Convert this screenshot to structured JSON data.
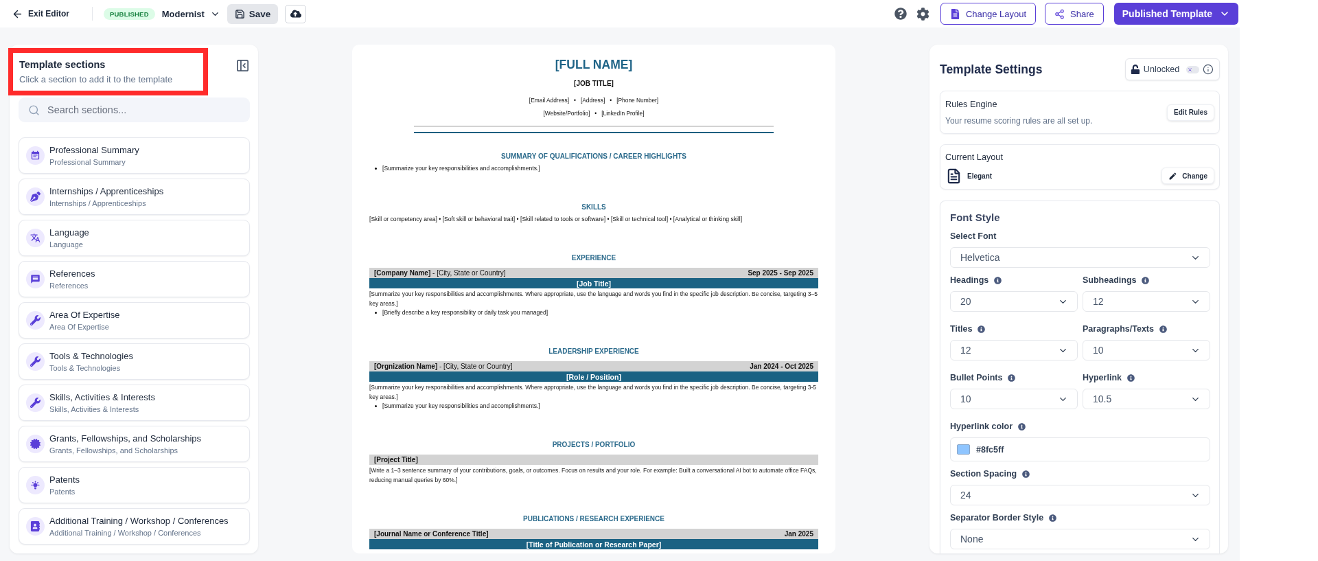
{
  "top_bar": {
    "exit_label": "Exit Editor",
    "status_badge": "PUBLISHED",
    "template_name": "Modernist",
    "save_label": "Save",
    "actions": [
      {
        "kind": "layout",
        "label": "Change Layout"
      },
      {
        "kind": "share",
        "label": "Share"
      }
    ],
    "publish_label": "Published Template"
  },
  "sections_panel": {
    "title": "Template sections",
    "subtitle": "Click a section to add it to the template",
    "highlighted": true,
    "search": {
      "placeholder": "Search sections..."
    },
    "items": [
      {
        "kind": "summary",
        "title": "Professional Summary",
        "subtitle": "Professional Summary"
      },
      {
        "kind": "internship",
        "title": "Internships / Apprenticeships",
        "subtitle": "Internships / Apprenticeships"
      },
      {
        "kind": "language",
        "title": "Language",
        "subtitle": "Language"
      },
      {
        "kind": "references",
        "title": "References",
        "subtitle": "References"
      },
      {
        "kind": "expertise",
        "title": "Area Of Expertise",
        "subtitle": "Area Of Expertise"
      },
      {
        "kind": "tools",
        "title": "Tools & Technologies",
        "subtitle": "Tools & Technologies"
      },
      {
        "kind": "skills",
        "title": "Skills, Activities & Interests",
        "subtitle": "Skills, Activities & Interests"
      },
      {
        "kind": "grants",
        "title": "Grants, Fellowships, and Scholarships",
        "subtitle": "Grants, Fellowships, and Scholarships"
      },
      {
        "kind": "patents",
        "title": "Patents",
        "subtitle": "Patents"
      },
      {
        "kind": "training",
        "title": "Additional Training / Workshop / Conferences",
        "subtitle": "Additional Training / Workshop / Conferences"
      }
    ]
  },
  "resume": {
    "name": "[FULL NAME]",
    "job_title": "[JOB TITLE]",
    "contact_lines": [
      "[Email Address]   •   [Address]   •   [Phone Number]",
      "[Website/Portfolio]   •   [LinkedIn Profile]"
    ],
    "sections": [
      {
        "kind": "bullets",
        "heading": "SUMMARY OF QUALIFICATIONS / CAREER HIGHLIGHTS",
        "bullets": [
          "[Summarize your key responsibilities and accomplishments.]"
        ]
      },
      {
        "kind": "line",
        "heading": "SKILLS",
        "text": "[Skill or competency area] • [Soft skill or behavioral trait] • [Skill related to tools or software] • [Skill or technical tool] • [Analytical or thinking skill]"
      },
      {
        "kind": "entries",
        "heading": "EXPERIENCE",
        "entries": [
          {
            "name": "[Company Name]",
            "location": "- [City, State or Country]",
            "dates": "Sep 2025 - Sep 2025",
            "role": "[Job Title]",
            "description": "[Summarize your key responsibilities and accomplishments. Where appropriate, use the language and words you find in the specific job description. Be concise, targeting 3–5 key areas.]",
            "bullets": [
              "[Briefly describe a key responsibility or daily task you managed]"
            ]
          }
        ]
      },
      {
        "kind": "entries",
        "heading": "LEADERSHIP EXPERIENCE",
        "entries": [
          {
            "name": "[Orgnization Name]",
            "location": "- [City, State or Country]",
            "dates": "Jan 2024 - Oct 2025",
            "role": "[Role / Position]",
            "description": "[Summarize your key responsibilities and accomplishments. Where appropriate, use the language and words you find in the specific job description. Be concise, targeting 3-5 key areas.]",
            "bullets": [
              "[Summarize your key responsibilities and accomplishments.]"
            ]
          }
        ]
      },
      {
        "kind": "entries",
        "heading": "PROJECTS / PORTFOLIO",
        "entries": [
          {
            "name": "[Project Title]",
            "description": "[Write a 1–3 sentence summary of your contributions, goals, or outcomes. Focus on results and your role. For example: Built a conversational AI bot to automate office FAQs, reducing manual queries by 60%.]"
          }
        ]
      },
      {
        "kind": "entries",
        "heading": "PUBLICATIONS / RESEARCH EXPERIENCE",
        "entries": [
          {
            "name": "[Journal Name or Conference Title]",
            "dates": "Jan 2025",
            "role": "[Title of Publication or Research Paper]"
          }
        ]
      }
    ]
  },
  "settings": {
    "title": "Template Settings",
    "lock": {
      "label": "Unlocked",
      "locked": false
    },
    "rules_engine": {
      "title": "Rules Engine",
      "description": "Your resume scoring rules are all set up.",
      "button": "Edit Rules"
    },
    "layout": {
      "title": "Current Layout",
      "name": "Elegant",
      "button": "Change"
    },
    "font_style": {
      "title": "Font Style",
      "rows": [
        [
          {
            "kind": "select",
            "label": "Select Font",
            "info": false,
            "value": "Helvetica"
          }
        ],
        [
          {
            "kind": "select",
            "label": "Headings",
            "info": true,
            "value": "20"
          },
          {
            "kind": "select",
            "label": "Subheadings",
            "info": true,
            "value": "12"
          }
        ],
        [
          {
            "kind": "select",
            "label": "Titles",
            "info": true,
            "value": "12"
          },
          {
            "kind": "select",
            "label": "Paragraphs/Texts",
            "info": true,
            "value": "10"
          }
        ],
        [
          {
            "kind": "select",
            "label": "Bullet Points",
            "info": true,
            "value": "10"
          },
          {
            "kind": "select",
            "label": "Hyperlink",
            "info": true,
            "value": "10.5"
          }
        ],
        [
          {
            "kind": "color",
            "label": "Hyperlink color",
            "info": true,
            "value": "#8fc5ff"
          }
        ],
        [
          {
            "kind": "select",
            "label": "Section Spacing",
            "info": true,
            "value": "24"
          }
        ],
        [
          {
            "kind": "select",
            "label": "Separator Border Style",
            "info": true,
            "value": "None"
          }
        ]
      ]
    }
  }
}
